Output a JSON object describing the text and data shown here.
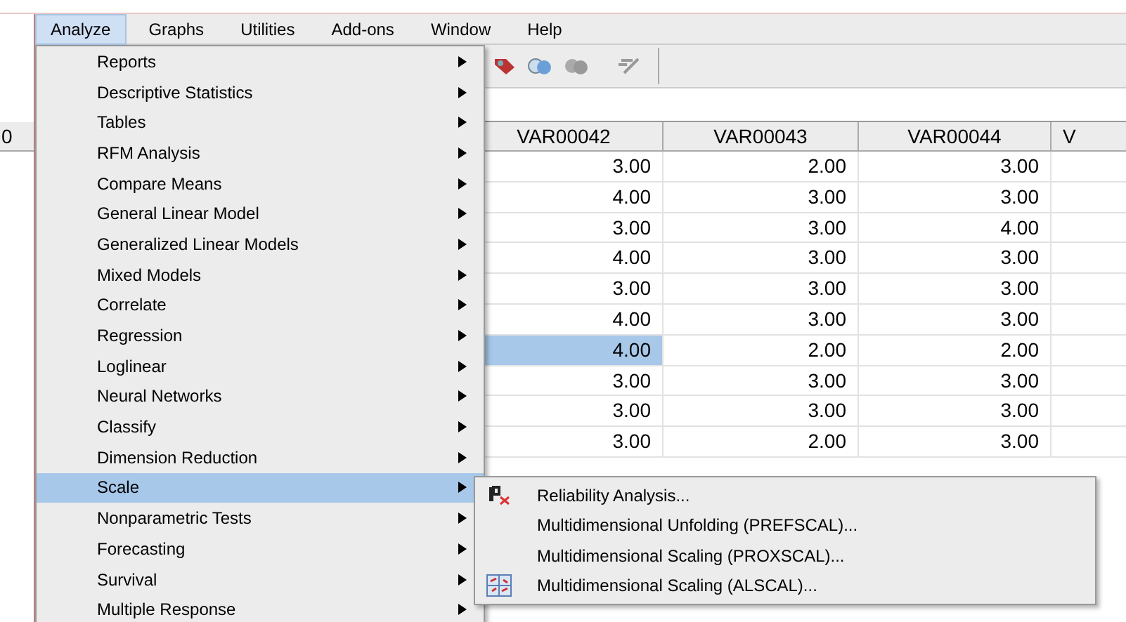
{
  "menubar": [
    {
      "label": "Analyze",
      "selected": true
    },
    {
      "label": "Graphs",
      "selected": false
    },
    {
      "label": "Utilities",
      "selected": false
    },
    {
      "label": "Add-ons",
      "selected": false
    },
    {
      "label": "Window",
      "selected": false
    },
    {
      "label": "Help",
      "selected": false
    }
  ],
  "table": {
    "columns": [
      "0",
      "VAR00042",
      "VAR00043",
      "VAR00044",
      "V"
    ],
    "rows": [
      {
        "cells": [
          {
            "text": "3.00",
            "selected": false
          },
          {
            "text": "2.00",
            "selected": false
          },
          {
            "text": "3.00",
            "selected": false
          }
        ]
      },
      {
        "cells": [
          {
            "text": "4.00",
            "selected": false
          },
          {
            "text": "3.00",
            "selected": false
          },
          {
            "text": "3.00",
            "selected": false
          }
        ]
      },
      {
        "cells": [
          {
            "text": "3.00",
            "selected": false
          },
          {
            "text": "3.00",
            "selected": false
          },
          {
            "text": "4.00",
            "selected": false
          }
        ]
      },
      {
        "cells": [
          {
            "text": "4.00",
            "selected": false
          },
          {
            "text": "3.00",
            "selected": false
          },
          {
            "text": "3.00",
            "selected": false
          }
        ]
      },
      {
        "cells": [
          {
            "text": "3.00",
            "selected": false
          },
          {
            "text": "3.00",
            "selected": false
          },
          {
            "text": "3.00",
            "selected": false
          }
        ]
      },
      {
        "cells": [
          {
            "text": "4.00",
            "selected": false
          },
          {
            "text": "3.00",
            "selected": false
          },
          {
            "text": "3.00",
            "selected": false
          }
        ]
      },
      {
        "cells": [
          {
            "text": "4.00",
            "selected": true
          },
          {
            "text": "2.00",
            "selected": false
          },
          {
            "text": "2.00",
            "selected": false
          }
        ]
      },
      {
        "cells": [
          {
            "text": "3.00",
            "selected": false
          },
          {
            "text": "3.00",
            "selected": false
          },
          {
            "text": "3.00",
            "selected": false
          }
        ]
      },
      {
        "cells": [
          {
            "text": "3.00",
            "selected": false
          },
          {
            "text": "3.00",
            "selected": false
          },
          {
            "text": "3.00",
            "selected": false
          }
        ]
      },
      {
        "cells": [
          {
            "text": "3.00",
            "selected": false
          },
          {
            "text": "2.00",
            "selected": false
          },
          {
            "text": "3.00",
            "selected": false
          }
        ]
      }
    ]
  },
  "menu": {
    "items": [
      {
        "label": "Reports",
        "selected": false
      },
      {
        "label": "Descriptive Statistics",
        "selected": false
      },
      {
        "label": "Tables",
        "selected": false
      },
      {
        "label": "RFM Analysis",
        "selected": false
      },
      {
        "label": "Compare Means",
        "selected": false
      },
      {
        "label": "General Linear Model",
        "selected": false
      },
      {
        "label": "Generalized Linear Models",
        "selected": false
      },
      {
        "label": "Mixed Models",
        "selected": false
      },
      {
        "label": "Correlate",
        "selected": false
      },
      {
        "label": "Regression",
        "selected": false
      },
      {
        "label": "Loglinear",
        "selected": false
      },
      {
        "label": "Neural Networks",
        "selected": false
      },
      {
        "label": "Classify",
        "selected": false
      },
      {
        "label": "Dimension Reduction",
        "selected": false
      },
      {
        "label": "Scale",
        "selected": true
      },
      {
        "label": "Nonparametric Tests",
        "selected": false
      },
      {
        "label": "Forecasting",
        "selected": false
      },
      {
        "label": "Survival",
        "selected": false
      },
      {
        "label": "Multiple Response",
        "selected": false
      }
    ]
  },
  "submenu": {
    "items": [
      {
        "label": "Reliability Analysis...",
        "kind": "reliability"
      },
      {
        "label": "Multidimensional Unfolding (PREFSCAL)...",
        "kind": "plain"
      },
      {
        "label": "Multidimensional Scaling (PROXSCAL)...",
        "kind": "plain"
      },
      {
        "label": "Multidimensional Scaling (ALSCAL)...",
        "kind": "scaling"
      }
    ]
  }
}
